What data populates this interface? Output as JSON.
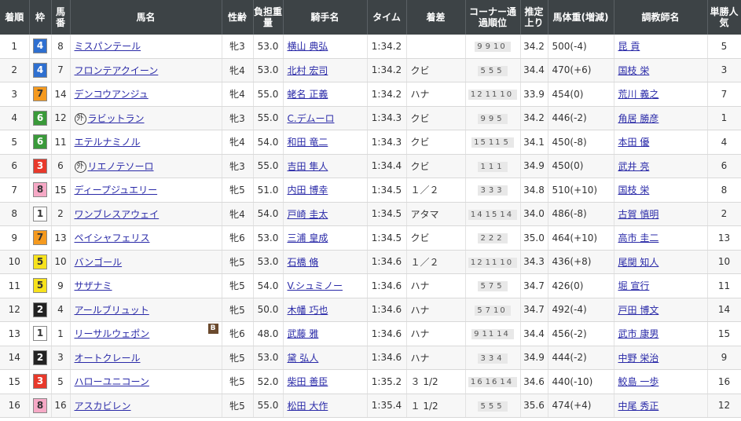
{
  "headers": {
    "rank": "着順",
    "waku": "枠",
    "umaban": "馬番",
    "horse": "馬名",
    "sexage": "性齢",
    "weight": "負担重量",
    "jockey": "騎手名",
    "time": "タイム",
    "margin": "着差",
    "corner": "コーナー通過順位",
    "last3f": "推定上り",
    "bodyweight": "馬体重(増減)",
    "trainer": "調教師名",
    "pop": "単勝人気"
  },
  "waku_colors": {
    "1": {
      "bg": "#ffffff",
      "fg": "#333333"
    },
    "2": {
      "bg": "#222222",
      "fg": "#ffffff"
    },
    "3": {
      "bg": "#e8392b",
      "fg": "#ffffff"
    },
    "4": {
      "bg": "#2e6fd0",
      "fg": "#ffffff"
    },
    "5": {
      "bg": "#f7e21c",
      "fg": "#333333"
    },
    "6": {
      "bg": "#3a9a3a",
      "fg": "#ffffff"
    },
    "7": {
      "bg": "#f59a1f",
      "fg": "#333333"
    },
    "8": {
      "bg": "#f6a9c6",
      "fg": "#333333"
    }
  },
  "rows": [
    {
      "rank": "1",
      "waku": "4",
      "umaban": "8",
      "horse": "ミスパンテール",
      "gai": "",
      "blinker": "",
      "sexage": "牝3",
      "weight": "53.0",
      "jockey": "横山 典弘",
      "time": "1:34.2",
      "margin": "",
      "corner": [
        "9",
        "9",
        "10"
      ],
      "last3f": "34.2",
      "bodyweight": "500(-4)",
      "trainer": "昆 貢",
      "pop": "5"
    },
    {
      "rank": "2",
      "waku": "4",
      "umaban": "7",
      "horse": "フロンテアクイーン",
      "gai": "",
      "blinker": "",
      "sexage": "牝4",
      "weight": "53.0",
      "jockey": "北村 宏司",
      "time": "1:34.2",
      "margin": "クビ",
      "corner": [
        "5",
        "5",
        "5"
      ],
      "last3f": "34.4",
      "bodyweight": "470(+6)",
      "trainer": "国枝 栄",
      "pop": "3"
    },
    {
      "rank": "3",
      "waku": "7",
      "umaban": "14",
      "horse": "デンコウアンジュ",
      "gai": "",
      "blinker": "",
      "sexage": "牝4",
      "weight": "55.0",
      "jockey": "蛯名 正義",
      "time": "1:34.2",
      "margin": "ハナ",
      "corner": [
        "12",
        "11",
        "10"
      ],
      "last3f": "33.9",
      "bodyweight": "454(0)",
      "trainer": "荒川 義之",
      "pop": "7"
    },
    {
      "rank": "4",
      "waku": "6",
      "umaban": "12",
      "horse": "ラビットラン",
      "gai": "外",
      "blinker": "",
      "sexage": "牝3",
      "weight": "55.0",
      "jockey": "C.デムーロ",
      "time": "1:34.3",
      "margin": "クビ",
      "corner": [
        "9",
        "9",
        "5"
      ],
      "last3f": "34.2",
      "bodyweight": "446(-2)",
      "trainer": "角居 勝彦",
      "pop": "1"
    },
    {
      "rank": "5",
      "waku": "6",
      "umaban": "11",
      "horse": "エテルナミノル",
      "gai": "",
      "blinker": "",
      "sexage": "牝4",
      "weight": "54.0",
      "jockey": "和田 竜二",
      "time": "1:34.3",
      "margin": "クビ",
      "corner": [
        "15",
        "11",
        "5"
      ],
      "last3f": "34.1",
      "bodyweight": "450(-8)",
      "trainer": "本田 優",
      "pop": "4"
    },
    {
      "rank": "6",
      "waku": "3",
      "umaban": "6",
      "horse": "リエノテソーロ",
      "gai": "外",
      "blinker": "",
      "sexage": "牝3",
      "weight": "55.0",
      "jockey": "吉田 隼人",
      "time": "1:34.4",
      "margin": "クビ",
      "corner": [
        "1",
        "1",
        "1"
      ],
      "last3f": "34.9",
      "bodyweight": "450(0)",
      "trainer": "武井 亮",
      "pop": "6"
    },
    {
      "rank": "7",
      "waku": "8",
      "umaban": "15",
      "horse": "ディープジュエリー",
      "gai": "",
      "blinker": "",
      "sexage": "牝5",
      "weight": "51.0",
      "jockey": "内田 博幸",
      "time": "1:34.5",
      "margin": "１／２",
      "corner": [
        "3",
        "3",
        "3"
      ],
      "last3f": "34.8",
      "bodyweight": "510(+10)",
      "trainer": "国枝 栄",
      "pop": "8"
    },
    {
      "rank": "8",
      "waku": "1",
      "umaban": "2",
      "horse": "ワンブレスアウェイ",
      "gai": "",
      "blinker": "",
      "sexage": "牝4",
      "weight": "54.0",
      "jockey": "戸崎 圭太",
      "time": "1:34.5",
      "margin": "アタマ",
      "corner": [
        "14",
        "15",
        "14"
      ],
      "last3f": "34.0",
      "bodyweight": "486(-8)",
      "trainer": "古賀 慎明",
      "pop": "2"
    },
    {
      "rank": "9",
      "waku": "7",
      "umaban": "13",
      "horse": "ペイシャフェリス",
      "gai": "",
      "blinker": "",
      "sexage": "牝6",
      "weight": "53.0",
      "jockey": "三浦 皇成",
      "time": "1:34.5",
      "margin": "クビ",
      "corner": [
        "2",
        "2",
        "2"
      ],
      "last3f": "35.0",
      "bodyweight": "464(+10)",
      "trainer": "高市 圭二",
      "pop": "13"
    },
    {
      "rank": "10",
      "waku": "5",
      "umaban": "10",
      "horse": "バンゴール",
      "gai": "",
      "blinker": "",
      "sexage": "牝5",
      "weight": "53.0",
      "jockey": "石橋 脩",
      "time": "1:34.6",
      "margin": "１／２",
      "corner": [
        "12",
        "11",
        "10"
      ],
      "last3f": "34.3",
      "bodyweight": "436(+8)",
      "trainer": "尾関 知人",
      "pop": "10"
    },
    {
      "rank": "11",
      "waku": "5",
      "umaban": "9",
      "horse": "サザナミ",
      "gai": "",
      "blinker": "",
      "sexage": "牝5",
      "weight": "54.0",
      "jockey": "V.シュミノー",
      "time": "1:34.6",
      "margin": "ハナ",
      "corner": [
        "5",
        "7",
        "5"
      ],
      "last3f": "34.7",
      "bodyweight": "426(0)",
      "trainer": "堀 宣行",
      "pop": "11"
    },
    {
      "rank": "12",
      "waku": "2",
      "umaban": "4",
      "horse": "アールブリュット",
      "gai": "",
      "blinker": "",
      "sexage": "牝5",
      "weight": "50.0",
      "jockey": "木幡 巧也",
      "time": "1:34.6",
      "margin": "ハナ",
      "corner": [
        "5",
        "7",
        "10"
      ],
      "last3f": "34.7",
      "bodyweight": "492(-4)",
      "trainer": "戸田 博文",
      "pop": "14"
    },
    {
      "rank": "13",
      "waku": "1",
      "umaban": "1",
      "horse": "リーサルウェポン",
      "gai": "",
      "blinker": "B",
      "sexage": "牝6",
      "weight": "48.0",
      "jockey": "武藤 雅",
      "time": "1:34.6",
      "margin": "ハナ",
      "corner": [
        "9",
        "11",
        "14"
      ],
      "last3f": "34.4",
      "bodyweight": "456(-2)",
      "trainer": "武市 康男",
      "pop": "15"
    },
    {
      "rank": "14",
      "waku": "2",
      "umaban": "3",
      "horse": "オートクレール",
      "gai": "",
      "blinker": "",
      "sexage": "牝5",
      "weight": "53.0",
      "jockey": "黛 弘人",
      "time": "1:34.6",
      "margin": "ハナ",
      "corner": [
        "3",
        "3",
        "4"
      ],
      "last3f": "34.9",
      "bodyweight": "444(-2)",
      "trainer": "中野 栄治",
      "pop": "9"
    },
    {
      "rank": "15",
      "waku": "3",
      "umaban": "5",
      "horse": "ハローユニコーン",
      "gai": "",
      "blinker": "",
      "sexage": "牝5",
      "weight": "52.0",
      "jockey": "柴田 善臣",
      "time": "1:35.2",
      "margin": "３ 1/2",
      "corner": [
        "16",
        "16",
        "14"
      ],
      "last3f": "34.6",
      "bodyweight": "440(-10)",
      "trainer": "鮫島 一歩",
      "pop": "16"
    },
    {
      "rank": "16",
      "waku": "8",
      "umaban": "16",
      "horse": "アスカビレン",
      "gai": "",
      "blinker": "",
      "sexage": "牝5",
      "weight": "55.0",
      "jockey": "松田 大作",
      "time": "1:35.4",
      "margin": "１ 1/2",
      "corner": [
        "5",
        "5",
        "5"
      ],
      "last3f": "35.6",
      "bodyweight": "474(+4)",
      "trainer": "中尾 秀正",
      "pop": "12"
    }
  ]
}
